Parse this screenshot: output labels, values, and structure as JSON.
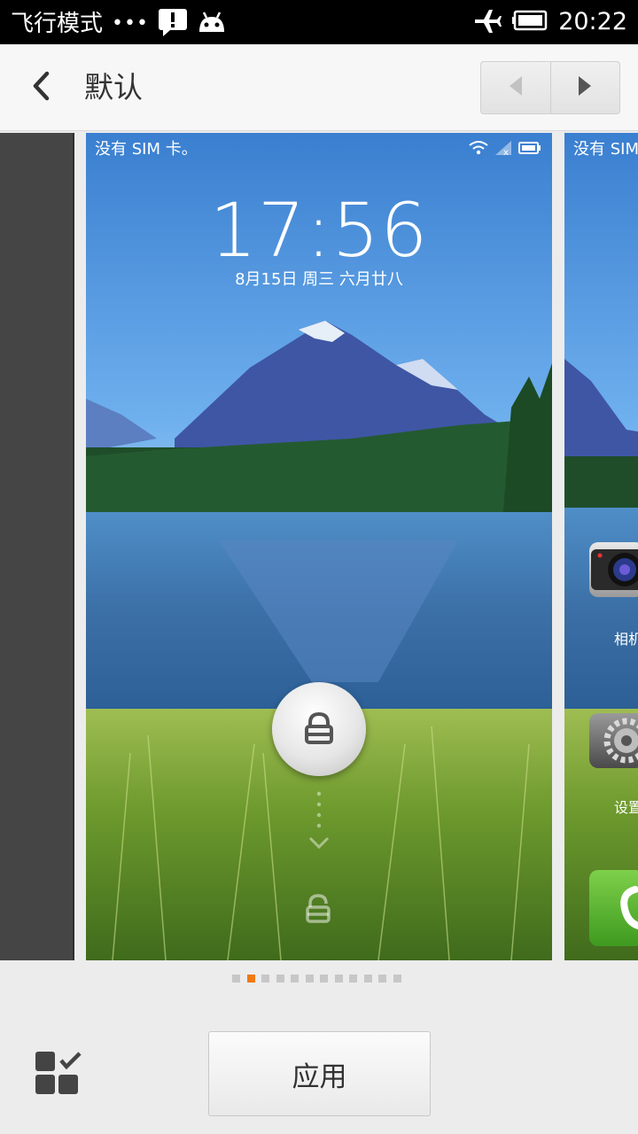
{
  "status_bar": {
    "left_text": "飞行模式",
    "dots": "•••",
    "time": "20:22",
    "icons": [
      "warning-icon",
      "android-icon",
      "airplane-icon",
      "battery-icon"
    ]
  },
  "header": {
    "title": "默认",
    "back_icon": "chevron-left-icon",
    "prev_icon": "triangle-left-icon",
    "next_icon": "triangle-right-icon"
  },
  "preview": {
    "status_text": "没有 SIM 卡。",
    "next_status_text": "没有 SIM",
    "time": "17:56",
    "date": "8月15日 周三   六月廿八",
    "unlock_icon": "lock-icon",
    "next_apps": [
      {
        "label": "相机",
        "icon": "camera-icon"
      },
      {
        "label": "设置",
        "icon": "settings-icon"
      },
      {
        "label": "",
        "icon": "phone-icon"
      }
    ]
  },
  "indicator": {
    "count": 12,
    "active": 1
  },
  "footer": {
    "apply_label": "应用",
    "grid_icon": "grid-check-icon"
  },
  "colors": {
    "accent": "#f07a10",
    "sky": "#4a8fd8",
    "status_bar_bg": "#000000"
  }
}
